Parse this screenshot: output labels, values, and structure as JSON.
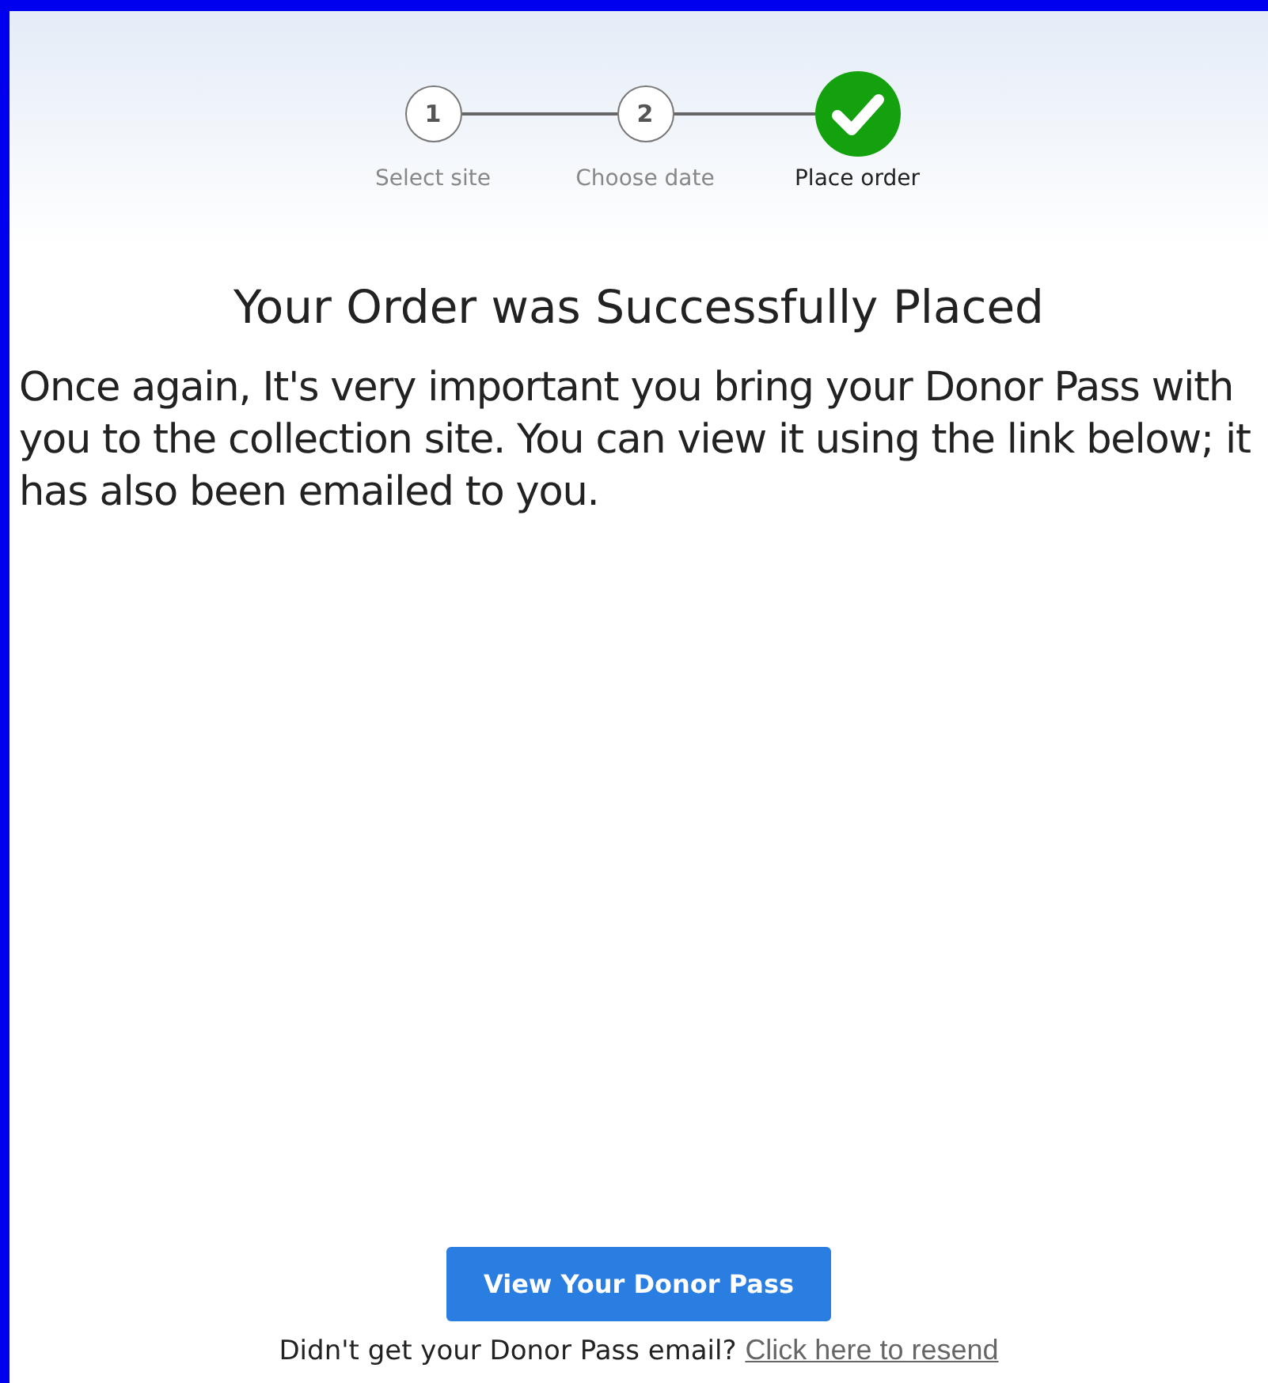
{
  "steps": [
    {
      "number": "1",
      "label": "Select site",
      "done": false,
      "selected": false
    },
    {
      "number": "2",
      "label": "Choose date",
      "done": false,
      "selected": false
    },
    {
      "label": "Place order",
      "done": true,
      "selected": true
    }
  ],
  "heading": "Your Order was Successfully Placed",
  "message": "Once again, It's very important you bring your Donor Pass with you to the collection site. You can view it using the link below; it has also been emailed to you.",
  "primary_button": "View Your Donor Pass",
  "resend": {
    "text": "Didn't get your Donor Pass email?",
    "link": "Click here to resend"
  }
}
